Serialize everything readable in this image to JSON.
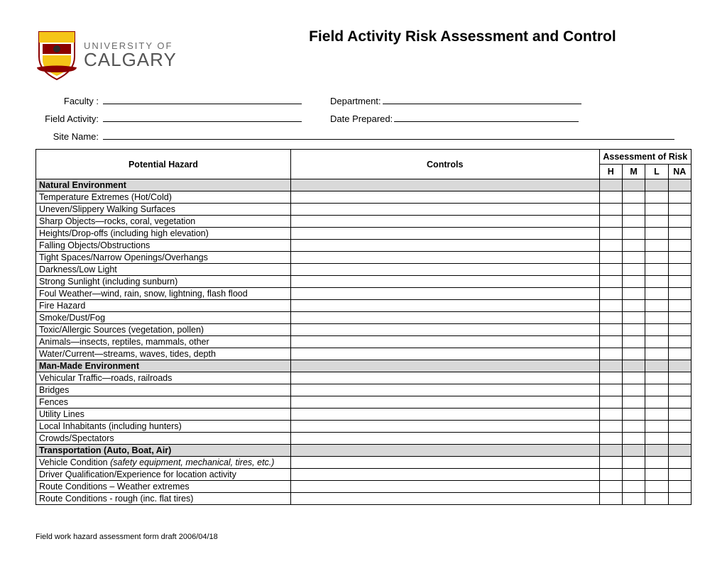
{
  "logo": {
    "line1": "UNIVERSITY OF",
    "line2": "CALGARY"
  },
  "title": "Field Activity Risk Assessment and Control",
  "fields": {
    "faculty_label": "Faculty :",
    "department_label": "Department:",
    "field_activity_label": "Field Activity:",
    "date_prepared_label": "Date Prepared:",
    "site_name_label": "Site Name:"
  },
  "table": {
    "headers": {
      "hazard": "Potential Hazard",
      "controls": "Controls",
      "assessment": "Assessment of Risk",
      "h": "H",
      "m": "M",
      "l": "L",
      "na": "NA"
    },
    "sections": [
      {
        "title": "Natural Environment",
        "rows": [
          {
            "text": "Temperature Extremes (Hot/Cold)"
          },
          {
            "text": "Uneven/Slippery Walking Surfaces"
          },
          {
            "text": "Sharp Objects—rocks, coral, vegetation"
          },
          {
            "text": "Heights/Drop-offs (including high elevation)"
          },
          {
            "text": "Falling Objects/Obstructions"
          },
          {
            "text": "Tight Spaces/Narrow Openings/Overhangs"
          },
          {
            "text": "Darkness/Low Light"
          },
          {
            "text": "Strong Sunlight (including sunburn)"
          },
          {
            "text": "Foul Weather—wind, rain, snow, lightning, flash flood"
          },
          {
            "text": "Fire Hazard"
          },
          {
            "text": "Smoke/Dust/Fog"
          },
          {
            "text": "Toxic/Allergic Sources (vegetation, pollen)"
          },
          {
            "text": "Animals—insects, reptiles, mammals, other"
          },
          {
            "text": "Water/Current—streams, waves, tides, depth"
          }
        ]
      },
      {
        "title": "Man-Made Environment",
        "rows": [
          {
            "text": "Vehicular Traffic—roads, railroads"
          },
          {
            "text": "Bridges"
          },
          {
            "text": "Fences"
          },
          {
            "text": "Utility Lines"
          },
          {
            "text": "Local Inhabitants (including hunters)"
          },
          {
            "text": "Crowds/Spectators"
          }
        ]
      },
      {
        "title": "Transportation (Auto, Boat, Air)",
        "rows": [
          {
            "text": "Vehicle Condition ",
            "italic": "(safety equipment, mechanical, tires, etc.)"
          },
          {
            "text": "Driver Qualification/Experience for location activity"
          },
          {
            "text": "Route Conditions –  Weather extremes"
          },
          {
            "text": "Route Conditions - rough (inc. flat tires)"
          }
        ]
      }
    ]
  },
  "footer": "Field work hazard assessment form draft 2006/04/18"
}
